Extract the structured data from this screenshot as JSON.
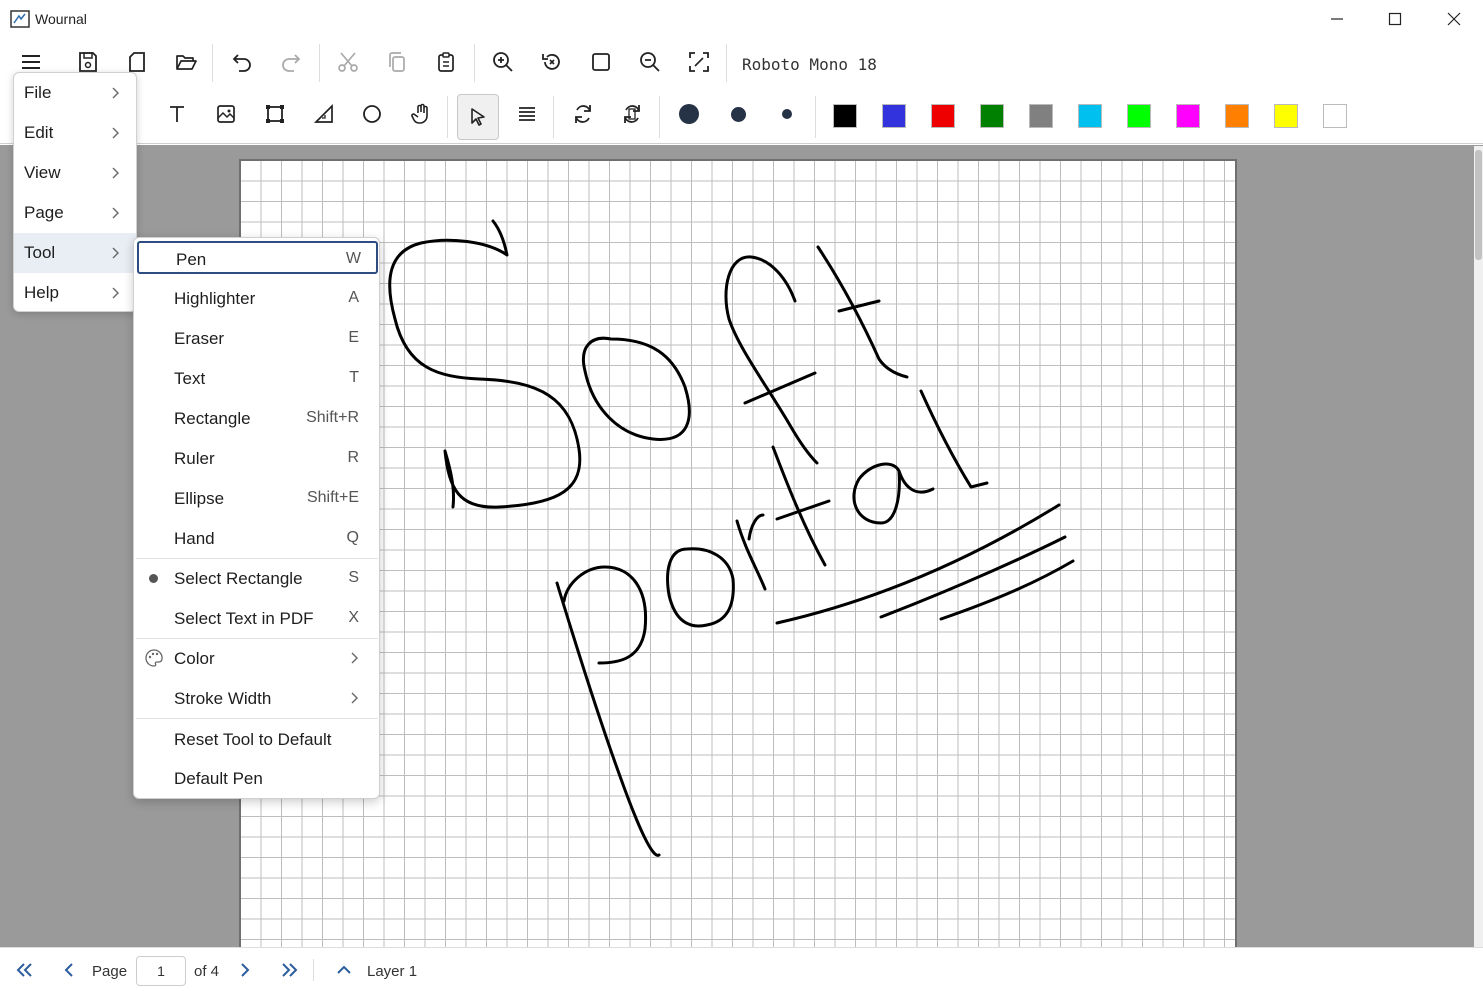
{
  "window": {
    "title": "Wournal"
  },
  "toolbar": {
    "font_label": "Roboto Mono 18"
  },
  "colors": [
    "#000000",
    "#3333dd",
    "#ee0000",
    "#008000",
    "#808080",
    "#00c0f0",
    "#00ff00",
    "#ff00ff",
    "#ff7f00",
    "#ffff00",
    "#ffffff"
  ],
  "main_menu": {
    "items": [
      {
        "label": "File"
      },
      {
        "label": "Edit"
      },
      {
        "label": "View"
      },
      {
        "label": "Page"
      },
      {
        "label": "Tool"
      },
      {
        "label": "Help"
      }
    ]
  },
  "tool_menu": {
    "items": [
      {
        "label": "Pen",
        "shortcut": "W"
      },
      {
        "label": "Highlighter",
        "shortcut": "A"
      },
      {
        "label": "Eraser",
        "shortcut": "E"
      },
      {
        "label": "Text",
        "shortcut": "T"
      },
      {
        "label": "Rectangle",
        "shortcut": "Shift+R"
      },
      {
        "label": "Ruler",
        "shortcut": "R"
      },
      {
        "label": "Ellipse",
        "shortcut": "Shift+E"
      },
      {
        "label": "Hand",
        "shortcut": "Q"
      },
      {
        "label": "Select Rectangle",
        "shortcut": "S"
      },
      {
        "label": "Select Text in PDF",
        "shortcut": "X"
      },
      {
        "label": "Color"
      },
      {
        "label": "Stroke Width"
      },
      {
        "label": "Reset Tool to Default"
      },
      {
        "label": "Default Pen"
      }
    ]
  },
  "statusbar": {
    "page_label": "Page",
    "page_value": "1",
    "page_total": "of 4",
    "layer": "Layer 1"
  }
}
